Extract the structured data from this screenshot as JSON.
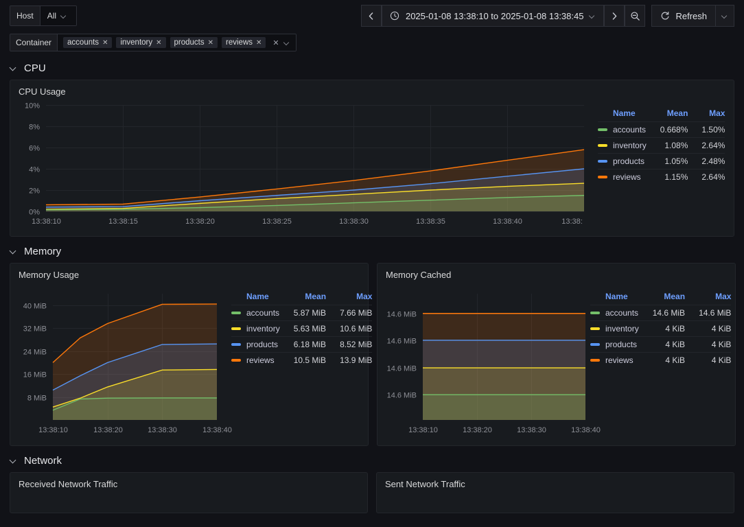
{
  "topbar": {
    "host_var": {
      "label": "Host",
      "value": "All"
    },
    "container_var": {
      "label": "Container",
      "chips": [
        "accounts",
        "inventory",
        "products",
        "reviews"
      ],
      "clear_label": "×"
    },
    "time": {
      "prev_label": "‹",
      "next_label": "›",
      "range": "2025-01-08 13:38:10 to 2025-01-08 13:38:45",
      "zoom_out_label": "zoom-out",
      "refresh_label": "Refresh"
    }
  },
  "sections": [
    {
      "title": "CPU"
    },
    {
      "title": "Memory"
    },
    {
      "title": "Network"
    }
  ],
  "panels": {
    "cpu_usage": {
      "title": "CPU Usage"
    },
    "memory_usage": {
      "title": "Memory Usage"
    },
    "memory_cached": {
      "title": "Memory Cached"
    },
    "received_network_traffic": {
      "title": "Received Network Traffic"
    },
    "sent_network_traffic": {
      "title": "Sent Network Traffic"
    }
  },
  "legend_headers": {
    "name": "Name",
    "mean": "Mean",
    "max": "Max"
  },
  "colors": {
    "accounts": "#73BF69",
    "inventory": "#FADE2A",
    "products": "#5794F2",
    "reviews": "#FF780A",
    "panel_bg": "#181b1f",
    "page_bg": "#111217",
    "grid": "#23262b",
    "header_blue": "#6e9fff"
  },
  "chart_data": [
    {
      "id": "cpu_usage",
      "type": "area",
      "title": "CPU Usage",
      "xlabel": "",
      "ylabel": "",
      "ylim": [
        0,
        10
      ],
      "yunit": "%",
      "ytick_labels": [
        "0%",
        "2%",
        "4%",
        "6%",
        "8%",
        "10%"
      ],
      "ytick_values": [
        0,
        2,
        4,
        6,
        8,
        10
      ],
      "xtick_labels": [
        "13:38:10",
        "13:38:15",
        "13:38:20",
        "13:38:25",
        "13:38:30",
        "13:38:35",
        "13:38:40",
        "13:38:"
      ],
      "x": [
        0,
        5,
        10,
        15,
        20,
        25,
        30,
        35
      ],
      "grid": true,
      "legend_position": "right",
      "series": [
        {
          "name": "accounts",
          "color": "#73BF69",
          "mean": "0.668%",
          "max": "1.50%",
          "values": [
            0.15,
            0.2,
            0.35,
            0.55,
            0.8,
            1.05,
            1.3,
            1.5
          ]
        },
        {
          "name": "inventory",
          "color": "#FADE2A",
          "mean": "1.08%",
          "max": "2.64%",
          "values": [
            0.2,
            0.28,
            0.75,
            1.2,
            1.6,
            2.0,
            2.35,
            2.64
          ]
        },
        {
          "name": "products",
          "color": "#5794F2",
          "mean": "1.05%",
          "max": "2.48%",
          "values": [
            0.4,
            0.45,
            1.0,
            1.5,
            2.0,
            2.6,
            3.3,
            4.0
          ]
        },
        {
          "name": "reviews",
          "color": "#FF780A",
          "mean": "1.15%",
          "max": "2.64%",
          "values": [
            0.62,
            0.68,
            1.35,
            2.1,
            2.9,
            3.8,
            4.8,
            5.8
          ]
        }
      ]
    },
    {
      "id": "memory_usage",
      "type": "area",
      "title": "Memory Usage",
      "xlabel": "",
      "ylabel": "",
      "ylim": [
        0,
        44
      ],
      "yunit": "MiB",
      "ytick_labels": [
        "8 MiB",
        "16 MiB",
        "24 MiB",
        "32 MiB",
        "40 MiB"
      ],
      "ytick_values": [
        8,
        16,
        24,
        32,
        40
      ],
      "xtick_labels": [
        "13:38:10",
        "13:38:20",
        "13:38:30",
        "13:38:40"
      ],
      "x": [
        0,
        5,
        10,
        20,
        30
      ],
      "grid": true,
      "legend_position": "right",
      "series": [
        {
          "name": "accounts",
          "color": "#73BF69",
          "mean": "5.87 MiB",
          "max": "7.66 MiB",
          "values": [
            3.4,
            7.3,
            7.6,
            7.66,
            7.66
          ]
        },
        {
          "name": "inventory",
          "color": "#FADE2A",
          "mean": "5.63 MiB",
          "max": "10.6 MiB",
          "values": [
            4.5,
            7.6,
            11.5,
            17.4,
            17.6
          ]
        },
        {
          "name": "products",
          "color": "#5794F2",
          "mean": "6.18 MiB",
          "max": "8.52 MiB",
          "values": [
            10.4,
            15.4,
            20.0,
            26.3,
            26.5
          ]
        },
        {
          "name": "reviews",
          "color": "#FF780A",
          "mean": "10.5 MiB",
          "max": "13.9 MiB",
          "values": [
            20.0,
            28.6,
            33.6,
            40.3,
            40.4
          ]
        }
      ]
    },
    {
      "id": "memory_cached",
      "type": "area",
      "title": "Memory Cached",
      "xlabel": "",
      "ylabel": "",
      "ylim": [
        0,
        16
      ],
      "yunit": "MiB",
      "ytick_labels": [
        "14.6 MiB",
        "14.6 MiB",
        "14.6 MiB",
        "14.6 MiB"
      ],
      "ytick_values": [
        3.2,
        6.6,
        10.1,
        13.5
      ],
      "xtick_labels": [
        "13:38:10",
        "13:38:20",
        "13:38:30",
        "13:38:40"
      ],
      "x": [
        0,
        30
      ],
      "grid": true,
      "legend_position": "right",
      "series": [
        {
          "name": "accounts",
          "color": "#73BF69",
          "mean": "14.6 MiB",
          "max": "14.6 MiB",
          "values": [
            3.2,
            3.2
          ]
        },
        {
          "name": "inventory",
          "color": "#FADE2A",
          "mean": "4 KiB",
          "max": "4 KiB",
          "values": [
            6.6,
            6.6
          ]
        },
        {
          "name": "products",
          "color": "#5794F2",
          "mean": "4 KiB",
          "max": "4 KiB",
          "values": [
            10.1,
            10.1
          ]
        },
        {
          "name": "reviews",
          "color": "#FF780A",
          "mean": "4 KiB",
          "max": "4 KiB",
          "values": [
            13.5,
            13.5
          ]
        }
      ]
    }
  ]
}
